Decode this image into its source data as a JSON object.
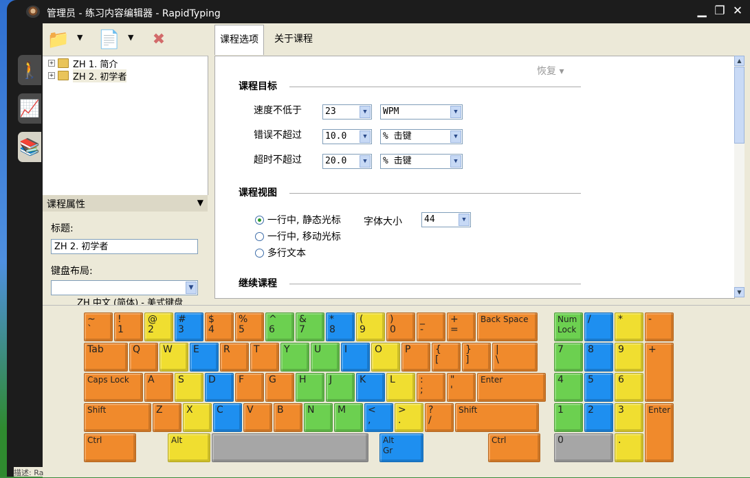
{
  "window": {
    "title": "管理员 - 练习内容编辑器 - RapidTyping",
    "min": "▁",
    "max": "❐",
    "close": "✕"
  },
  "side_tabs": [
    {
      "name": "lessons-tab-icon",
      "glyph": "🚶"
    },
    {
      "name": "stats-tab-icon",
      "glyph": "📈"
    },
    {
      "name": "editor-tab-icon",
      "glyph": "📚"
    }
  ],
  "toolbar": {
    "add_folder": "📁",
    "add_lesson": "📄",
    "delete": "✖",
    "drop": "▼"
  },
  "tree": {
    "items": [
      {
        "expander": "+",
        "label": "ZH 1. 简介"
      },
      {
        "expander": "+",
        "label": "ZH 2. 初学者"
      }
    ]
  },
  "props": {
    "header": "课程属性",
    "header_drop": "▼",
    "title_label": "标题:",
    "title_value": "ZH 2. 初学者",
    "layout_label": "键盘布局:",
    "layout_value": "ZH 中文 (简体) - 美式键盘"
  },
  "tabs": [
    {
      "label": "课程选项",
      "active": true
    },
    {
      "label": "关于课程",
      "active": false
    }
  ],
  "options": {
    "restore": "恢复 ▾",
    "goal_title": "课程目标",
    "speed_label": "速度不低于",
    "speed_value": "23",
    "speed_unit": "WPM",
    "errors_label": "错误不超过",
    "errors_value": "10.0",
    "errors_unit": "% 击键",
    "timeout_label": "超时不超过",
    "timeout_value": "20.0",
    "timeout_unit": "% 击键",
    "view_title": "课程视图",
    "view_options": [
      "一行中, 静态光标",
      "一行中, 移动光标",
      "多行文本"
    ],
    "view_selected": 0,
    "font_size_label": "字体大小",
    "font_size_value": "44",
    "continue_title": "继续课程"
  },
  "scroll_arrow_up": "▲",
  "scroll_arrow_down": "▼",
  "combo_arrow": "▼",
  "keyboard": {
    "row1": [
      "~\n`",
      "!\n1",
      "@\n2",
      "#\n3",
      "$\n4",
      "%\n5",
      "^\n6",
      "&\n7",
      "*\n8",
      "(\n9",
      ")\n0",
      "_\n-",
      "+\n=",
      "Back Space"
    ],
    "row2": [
      "Tab",
      "Q",
      "W",
      "E",
      "R",
      "T",
      "Y",
      "U",
      "I",
      "O",
      "P",
      "{\n[",
      "}\n]",
      "|\n\\"
    ],
    "row3": [
      "Caps Lock",
      "A",
      "S",
      "D",
      "F",
      "G",
      "H",
      "J",
      "K",
      "L",
      ":\n;",
      "\"\n'",
      "Enter"
    ],
    "row4": [
      "Shift",
      "Z",
      "X",
      "C",
      "V",
      "B",
      "N",
      "M",
      "<\n,",
      ">\n.",
      "?\n/",
      "Shift"
    ],
    "row5": [
      "Ctrl",
      "Alt",
      "",
      "Alt\nGr",
      "Ctrl"
    ],
    "numpad": [
      "Num\nLock",
      "/",
      "*",
      "-",
      "7",
      "8",
      "9",
      "+",
      "4",
      "5",
      "6",
      "1",
      "2",
      "3",
      "Enter",
      "0",
      "."
    ]
  },
  "status": "描述: Ra"
}
